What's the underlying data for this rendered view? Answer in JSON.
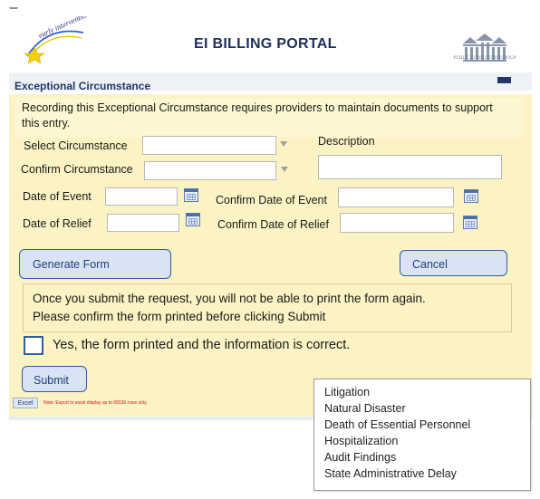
{
  "header": {
    "title": "EI BILLING PORTAL",
    "left_logo_text": "early intervention",
    "right_logo_text": "PUBLIC CONSULTING GROUP"
  },
  "section": {
    "title": "Exceptional Circumstance"
  },
  "form": {
    "intro": "Recording this Exceptional Circumstance requires providers to maintain documents to support this entry.",
    "select_circumstance_label": "Select Circumstance",
    "confirm_circumstance_label": "Confirm Circumstance",
    "description_label": "Description",
    "date_of_event_label": "Date of Event",
    "confirm_date_of_event_label": "Confirm Date of Event",
    "date_of_relief_label": "Date of Relief",
    "confirm_date_of_relief_label": "Confirm Date of Relief",
    "select_circumstance_value": "",
    "confirm_circumstance_value": "",
    "description_value": "",
    "date_of_event_value": "",
    "confirm_date_of_event_value": "",
    "date_of_relief_value": "",
    "confirm_date_of_relief_value": ""
  },
  "buttons": {
    "generate_form": "Generate Form",
    "cancel": "Cancel",
    "submit": "Submit",
    "excel": "Excel"
  },
  "notice": {
    "line1": "Once you submit the request, you will not  be able to print the form again.",
    "line2": "Please confirm the form printed before clicking Submit"
  },
  "confirmation": {
    "label": "Yes, the form printed and the information is correct.",
    "checked": false
  },
  "excel_note": "Note: Export to excel display up to 65536 rows only.",
  "dropdown_options": [
    "Litigation",
    "Natural Disaster",
    "Death of Essential Personnel",
    "Hospitalization",
    "Audit Findings",
    "State Administrative Delay"
  ],
  "icons": {
    "collapse": "collapse-arrow-icon",
    "select_arrow": "chevron-down-icon",
    "calendar": "calendar-icon",
    "checkbox": "checkbox-icon"
  },
  "colors": {
    "panel_background": "#fbf3c3",
    "title_color": "#1f2f5a",
    "button_border": "#2f5f9e",
    "button_fill": "#d9e3f3",
    "note_red": "#dd1111"
  }
}
